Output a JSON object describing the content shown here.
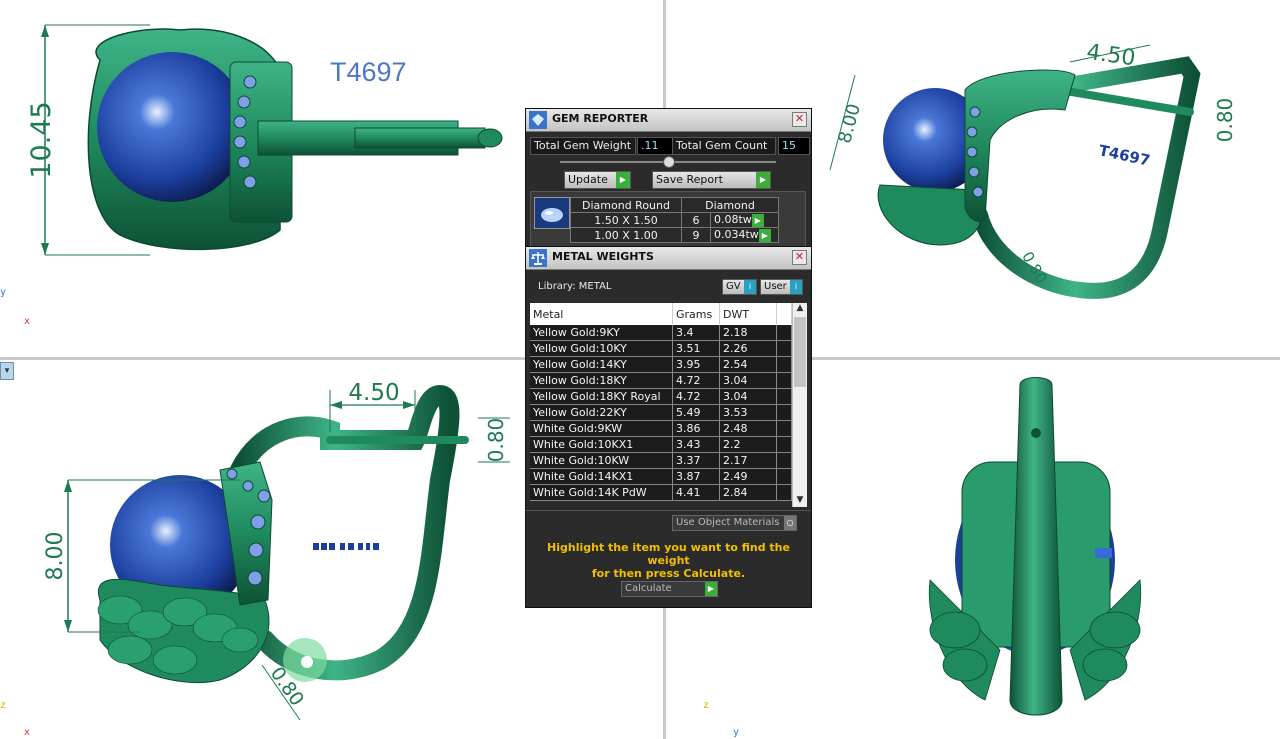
{
  "model_label": "T4697",
  "viewports": {
    "top_left": {
      "dimension": "10.45"
    },
    "top_right": {
      "dim_a": "4.50",
      "dim_b": "0.80",
      "dim_c": "8.00",
      "dim_d": "0.80",
      "engraving": "T4697"
    },
    "bottom_left": {
      "dim_a": "4.50",
      "dim_b": "0.80",
      "dim_c": "8.00",
      "dim_d": "0.80"
    }
  },
  "axes": {
    "y": "y",
    "x": "x",
    "z": "z"
  },
  "gem_reporter": {
    "title": "GEM REPORTER",
    "total_weight_label": "Total Gem Weight",
    "total_weight_value": ".11",
    "total_count_label": "Total Gem Count",
    "total_count_value": "15",
    "update_label": "Update",
    "save_report_label": "Save Report",
    "header_shape": "Diamond Round",
    "header_type": "Diamond",
    "rows": [
      {
        "size": "1.50 X 1.50",
        "count": "6",
        "weight": "0.08tw"
      },
      {
        "size": "1.00 X 1.00",
        "count": "9",
        "weight": "0.034tw"
      }
    ]
  },
  "metal_weights": {
    "title": "METAL WEIGHTS",
    "library_label": "Library: METAL",
    "gv_label": "GV",
    "user_label": "User",
    "columns": [
      "Metal",
      "Grams",
      "DWT"
    ],
    "rows": [
      {
        "metal": "Yellow Gold:9KY",
        "grams": "3.4",
        "dwt": "2.18"
      },
      {
        "metal": "Yellow Gold:10KY",
        "grams": "3.51",
        "dwt": "2.26"
      },
      {
        "metal": "Yellow Gold:14KY",
        "grams": "3.95",
        "dwt": "2.54"
      },
      {
        "metal": "Yellow Gold:18KY",
        "grams": "4.72",
        "dwt": "3.04"
      },
      {
        "metal": "Yellow Gold:18KY Royal",
        "grams": "4.72",
        "dwt": "3.04"
      },
      {
        "metal": "Yellow Gold:22KY",
        "grams": "5.49",
        "dwt": "3.53"
      },
      {
        "metal": "White Gold:9KW",
        "grams": "3.86",
        "dwt": "2.48"
      },
      {
        "metal": "White Gold:10KX1",
        "grams": "3.43",
        "dwt": "2.2"
      },
      {
        "metal": "White Gold:10KW",
        "grams": "3.37",
        "dwt": "2.17"
      },
      {
        "metal": "White Gold:14KX1",
        "grams": "3.87",
        "dwt": "2.49"
      },
      {
        "metal": "White Gold:14K PdW",
        "grams": "4.41",
        "dwt": "2.84"
      }
    ],
    "use_object_materials_label": "Use Object Materials",
    "hint_line1": "Highlight the item you want to find the weight",
    "hint_line2": "for then press Calculate.",
    "calculate_label": "Calculate"
  },
  "colors": {
    "metal": "#1f8a5e",
    "gem": "#1c3f9e",
    "dimension": "#1d7a52",
    "panel": "#2b2b2b",
    "hint": "#f0c000"
  }
}
